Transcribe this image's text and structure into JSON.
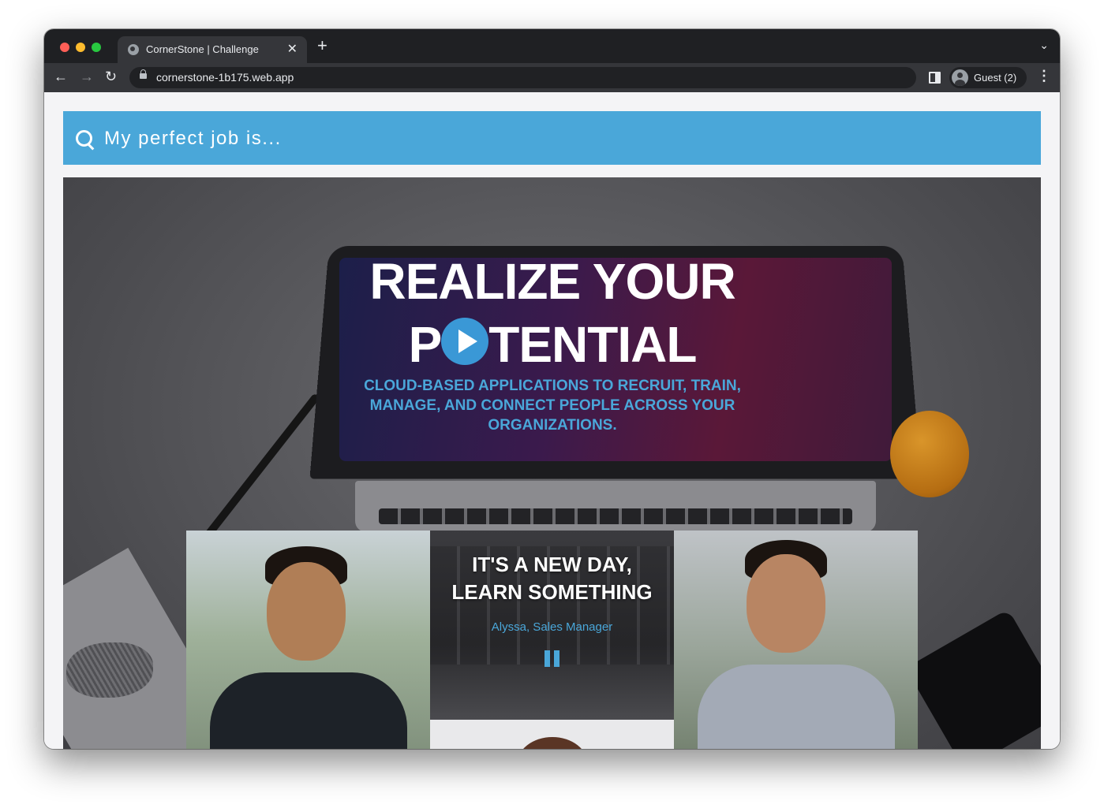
{
  "browser": {
    "tab_title": "CornerStone | Challenge",
    "tab_close": "✕",
    "new_tab": "+",
    "tab_search": "⌄",
    "url": "cornerstone-1b175.web.app",
    "back": "←",
    "forward": "→",
    "reload": "↻",
    "profile_label": "Guest (2)",
    "menu": "⋮"
  },
  "search": {
    "placeholder": "My perfect job is..."
  },
  "hero": {
    "title_line1": "REALIZE YOUR",
    "title_line2_start": "P",
    "title_line2_end": "TENTIAL",
    "subtitle": "CLOUD-BASED APPLICATIONS TO RECRUIT, TRAIN, MANAGE, AND CONNECT PEOPLE ACROSS YOUR ORGANIZATIONS."
  },
  "testimonial": {
    "quote_line1": "IT'S A NEW DAY,",
    "quote_line2": "LEARN SOMETHING",
    "author": "Alyssa, Sales Manager"
  },
  "colors": {
    "accent": "#4aa7d9",
    "play_icon": "#3a98d6"
  },
  "icons": {
    "search": "search-icon",
    "play": "play-icon",
    "pause": "pause-icon"
  }
}
